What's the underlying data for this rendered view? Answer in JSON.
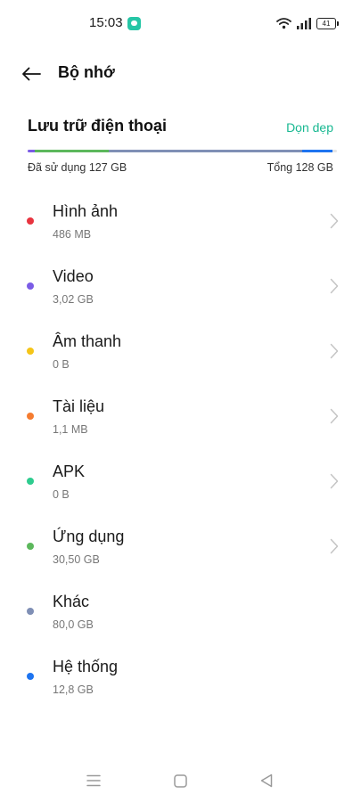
{
  "status": {
    "time": "15:03",
    "battery": "41"
  },
  "header": {
    "title": "Bộ nhớ"
  },
  "storage": {
    "title": "Lưu trữ điện thoại",
    "clean_label": "Dọn dẹp",
    "used": "Đã sử dụng 127 GB",
    "total": "Tổng 128 GB"
  },
  "categories": [
    {
      "label": "Hình ảnh",
      "size": "486 MB",
      "color": "#e8343f",
      "chevron": true
    },
    {
      "label": "Video",
      "size": "3,02 GB",
      "color": "#7b5ce6",
      "chevron": true
    },
    {
      "label": "Âm thanh",
      "size": "0 B",
      "color": "#f5c518",
      "chevron": true
    },
    {
      "label": "Tài liệu",
      "size": "1,1 MB",
      "color": "#f57c30",
      "chevron": true
    },
    {
      "label": "APK",
      "size": "0 B",
      "color": "#2ecc8f",
      "chevron": true
    },
    {
      "label": "Ứng dụng",
      "size": "30,50  GB",
      "color": "#5cb85c",
      "chevron": true
    },
    {
      "label": "Khác",
      "size": "80,0 GB",
      "color": "#7f8fb5",
      "chevron": false
    },
    {
      "label": "Hệ thống",
      "size": "12,8 GB",
      "color": "#1e74f0",
      "chevron": false
    }
  ],
  "usage_bar": [
    {
      "color": "#7b5ce6",
      "fraction": 0.024
    },
    {
      "color": "#5cb85c",
      "fraction": 0.238
    },
    {
      "color": "#7f8fb5",
      "fraction": 0.625
    },
    {
      "color": "#1e74f0",
      "fraction": 0.1
    }
  ]
}
